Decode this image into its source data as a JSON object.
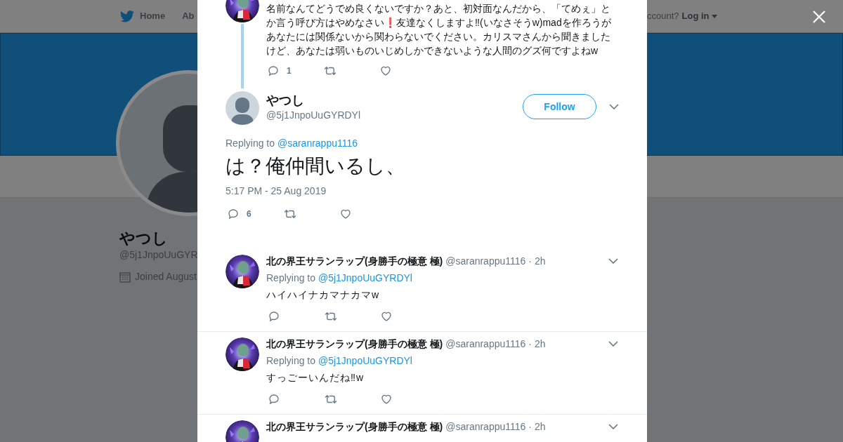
{
  "nav": {
    "items": [
      {
        "label": "Home",
        "kind": "logo"
      },
      {
        "label": "Ab",
        "kind": "plain"
      }
    ],
    "login_prompt": "ccount?",
    "login": "Log in"
  },
  "profile": {
    "name": "やつし",
    "handle": "@5j1JnpoUuGYR",
    "joined": "Joined August"
  },
  "thread_parent": {
    "text": "名前なんてどうでめ良くないですか？あと、初対面なんだから、「てめぇ」とか言う呼び方はやめなさい❗友達なくしますよ‼(いなさそうw)madを作ろうがあなたには関係ないから関わらないでください。カリスマさんから聞きましたけど、あなたは弱いものいじめしかできないような人間のグズ何ですよねw",
    "reply_count": "1"
  },
  "main_tweet": {
    "name": "やつし",
    "handle": "@5j1JnpoUuGYRDYl",
    "follow": "Follow",
    "replying_label": "Replying to",
    "replying_to": "@saranrappu1116",
    "text": "は？俺仲間いるし、",
    "timestamp": "5:17 PM - 25 Aug 2019",
    "reply_count": "6"
  },
  "replies": [
    {
      "name": "北の界王サランラップ(身勝手の極意 極)",
      "handle": "@saranrappu1116",
      "time": "· 2h",
      "replying_label": "Replying to",
      "replying_to": "@5j1JnpoUuGYRDYl",
      "text": "ハイハイナカマナカマw"
    },
    {
      "name": "北の界王サランラップ(身勝手の極意 極)",
      "handle": "@saranrappu1116",
      "time": "· 2h",
      "replying_label": "Replying to",
      "replying_to": "@5j1JnpoUuGYRDYl",
      "text": "すっごーいんだね‼w"
    },
    {
      "name": "北の界王サランラップ(身勝手の極意 極)",
      "handle": "@saranrappu1116",
      "time": "· 2h"
    }
  ]
}
